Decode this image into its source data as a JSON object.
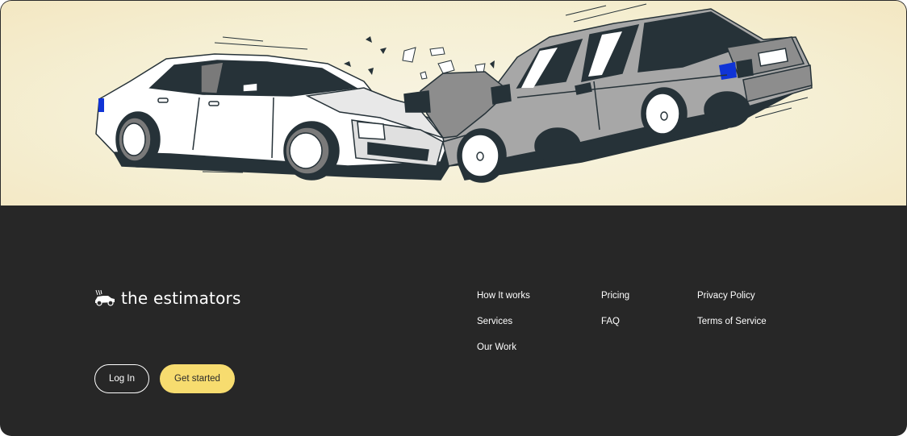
{
  "brand": {
    "name": "the estimators",
    "logo_icon": "crashed-car-logo-icon"
  },
  "hero": {
    "illustration": "car-collision-illustration"
  },
  "footer": {
    "links": {
      "col1": [
        "How It works",
        "Services",
        "Our Work"
      ],
      "col2": [
        "Pricing",
        "FAQ"
      ],
      "col3": [
        "Privacy Policy",
        "Terms of Service"
      ]
    },
    "buttons": {
      "login": "Log In",
      "get_started": "Get started"
    }
  },
  "colors": {
    "footer_bg": "#272727",
    "hero_bg": "#f5efd3",
    "accent_yellow": "#f7dc6f",
    "car_white": "#ffffff",
    "car_gray": "#a7a7a7",
    "outline": "#263238",
    "taillight_blue": "#1034d6"
  }
}
